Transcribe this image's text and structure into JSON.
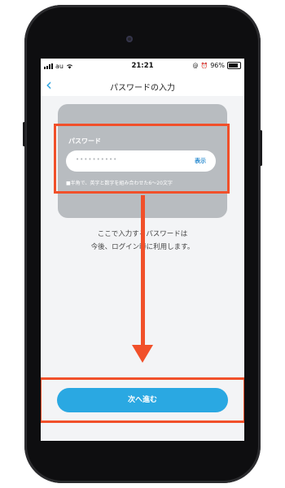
{
  "status_bar": {
    "carrier": "au",
    "time": "21:21",
    "battery_percent": "96%"
  },
  "nav": {
    "back_icon": "chevron-left-icon",
    "title": "パスワードの入力"
  },
  "password_form": {
    "label": "パスワード",
    "input_value": "••••••••••",
    "show_label": "表示",
    "hint": "■半角で、英字と数字を組み合わせた6～20文字"
  },
  "description": {
    "line1": "ここで入力するパスワードは",
    "line2": "今後、ログイン時に利用します。"
  },
  "next_button": {
    "label": "次へ進む"
  },
  "colors": {
    "accent": "#2aa8e2",
    "highlight": "#f1502a",
    "card": "#b8bcc0"
  }
}
